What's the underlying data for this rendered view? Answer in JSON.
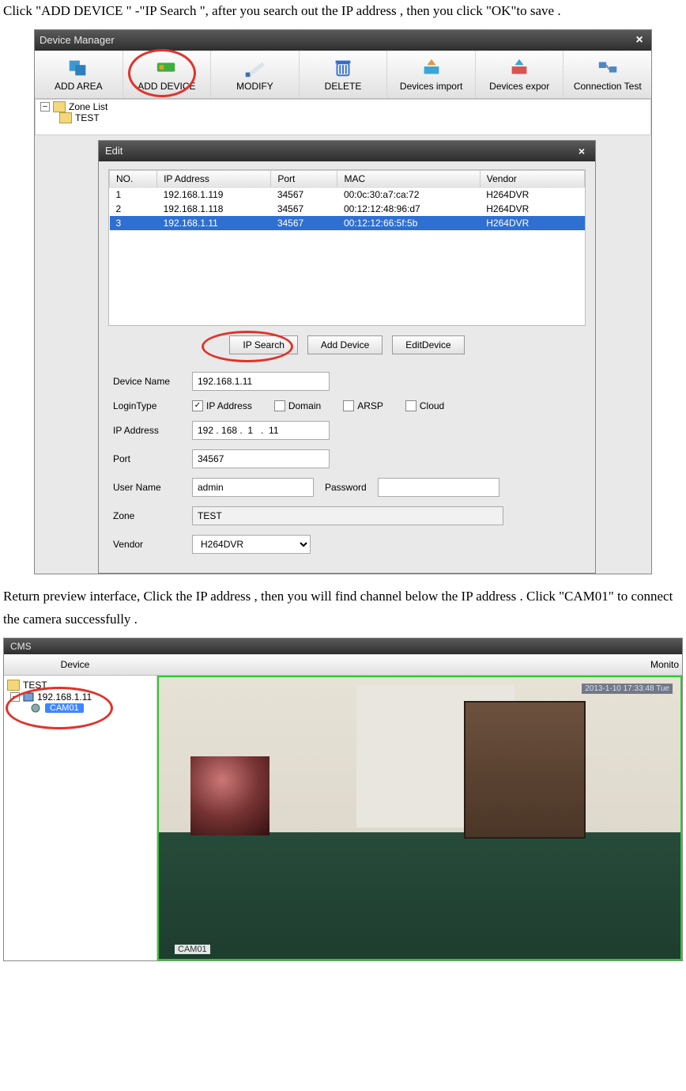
{
  "instr1": "Click \"ADD DEVICE \" -\"IP Search \", after you search out the IP address , then you click \"OK\"to save .",
  "instr2": "Return preview interface, Click the IP address , then you will find channel below the IP address . Click \"CAM01\" to connect the camera successfully .",
  "dm": {
    "title": "Device Manager",
    "toolbar": {
      "add_area": "ADD AREA",
      "add_device": "ADD DEVICE",
      "modify": "MODIFY",
      "delete": "DELETE",
      "import": "Devices import",
      "export": "Devices expor",
      "conn": "Connection Test"
    },
    "tree": {
      "root": "Zone List",
      "child": "TEST"
    }
  },
  "edit": {
    "title": "Edit",
    "headers": {
      "no": "NO.",
      "ip": "IP Address",
      "port": "Port",
      "mac": "MAC",
      "vendor": "Vendor"
    },
    "rows": [
      {
        "no": "1",
        "ip": "192.168.1.119",
        "port": "34567",
        "mac": "00:0c:30:a7:ca:72",
        "vendor": "H264DVR"
      },
      {
        "no": "2",
        "ip": "192.168.1.118",
        "port": "34567",
        "mac": "00:12:12:48:96:d7",
        "vendor": "H264DVR"
      },
      {
        "no": "3",
        "ip": "192.168.1.11",
        "port": "34567",
        "mac": "00:12:12:66:5f:5b",
        "vendor": "H264DVR"
      }
    ],
    "buttons": {
      "ip_search": "IP Search",
      "add_device": "Add Device",
      "edit_device": "EditDevice"
    },
    "form": {
      "device_name_label": "Device Name",
      "device_name": "192.168.1.11",
      "login_type_label": "LoginType",
      "opt_ip": "IP Address",
      "opt_domain": "Domain",
      "opt_arsp": "ARSP",
      "opt_cloud": "Cloud",
      "ip_label": "IP Address",
      "ip_value": "192 . 168 .  1   .  11",
      "port_label": "Port",
      "port_value": "34567",
      "user_label": "User Name",
      "user_value": "admin",
      "password_label": "Password",
      "password_value": "",
      "zone_label": "Zone",
      "zone_value": "TEST",
      "vendor_label": "Vendor",
      "vendor_value": "H264DVR"
    }
  },
  "cms": {
    "title": "CMS",
    "tab_device": "Device",
    "tab_monitor": "Monito",
    "tree": {
      "root": "TEST",
      "ip": "192.168.1.11",
      "cam": "CAM01"
    },
    "osd": "2013-1-10 17:33:48 Tue",
    "camlabel": "CAM01"
  }
}
